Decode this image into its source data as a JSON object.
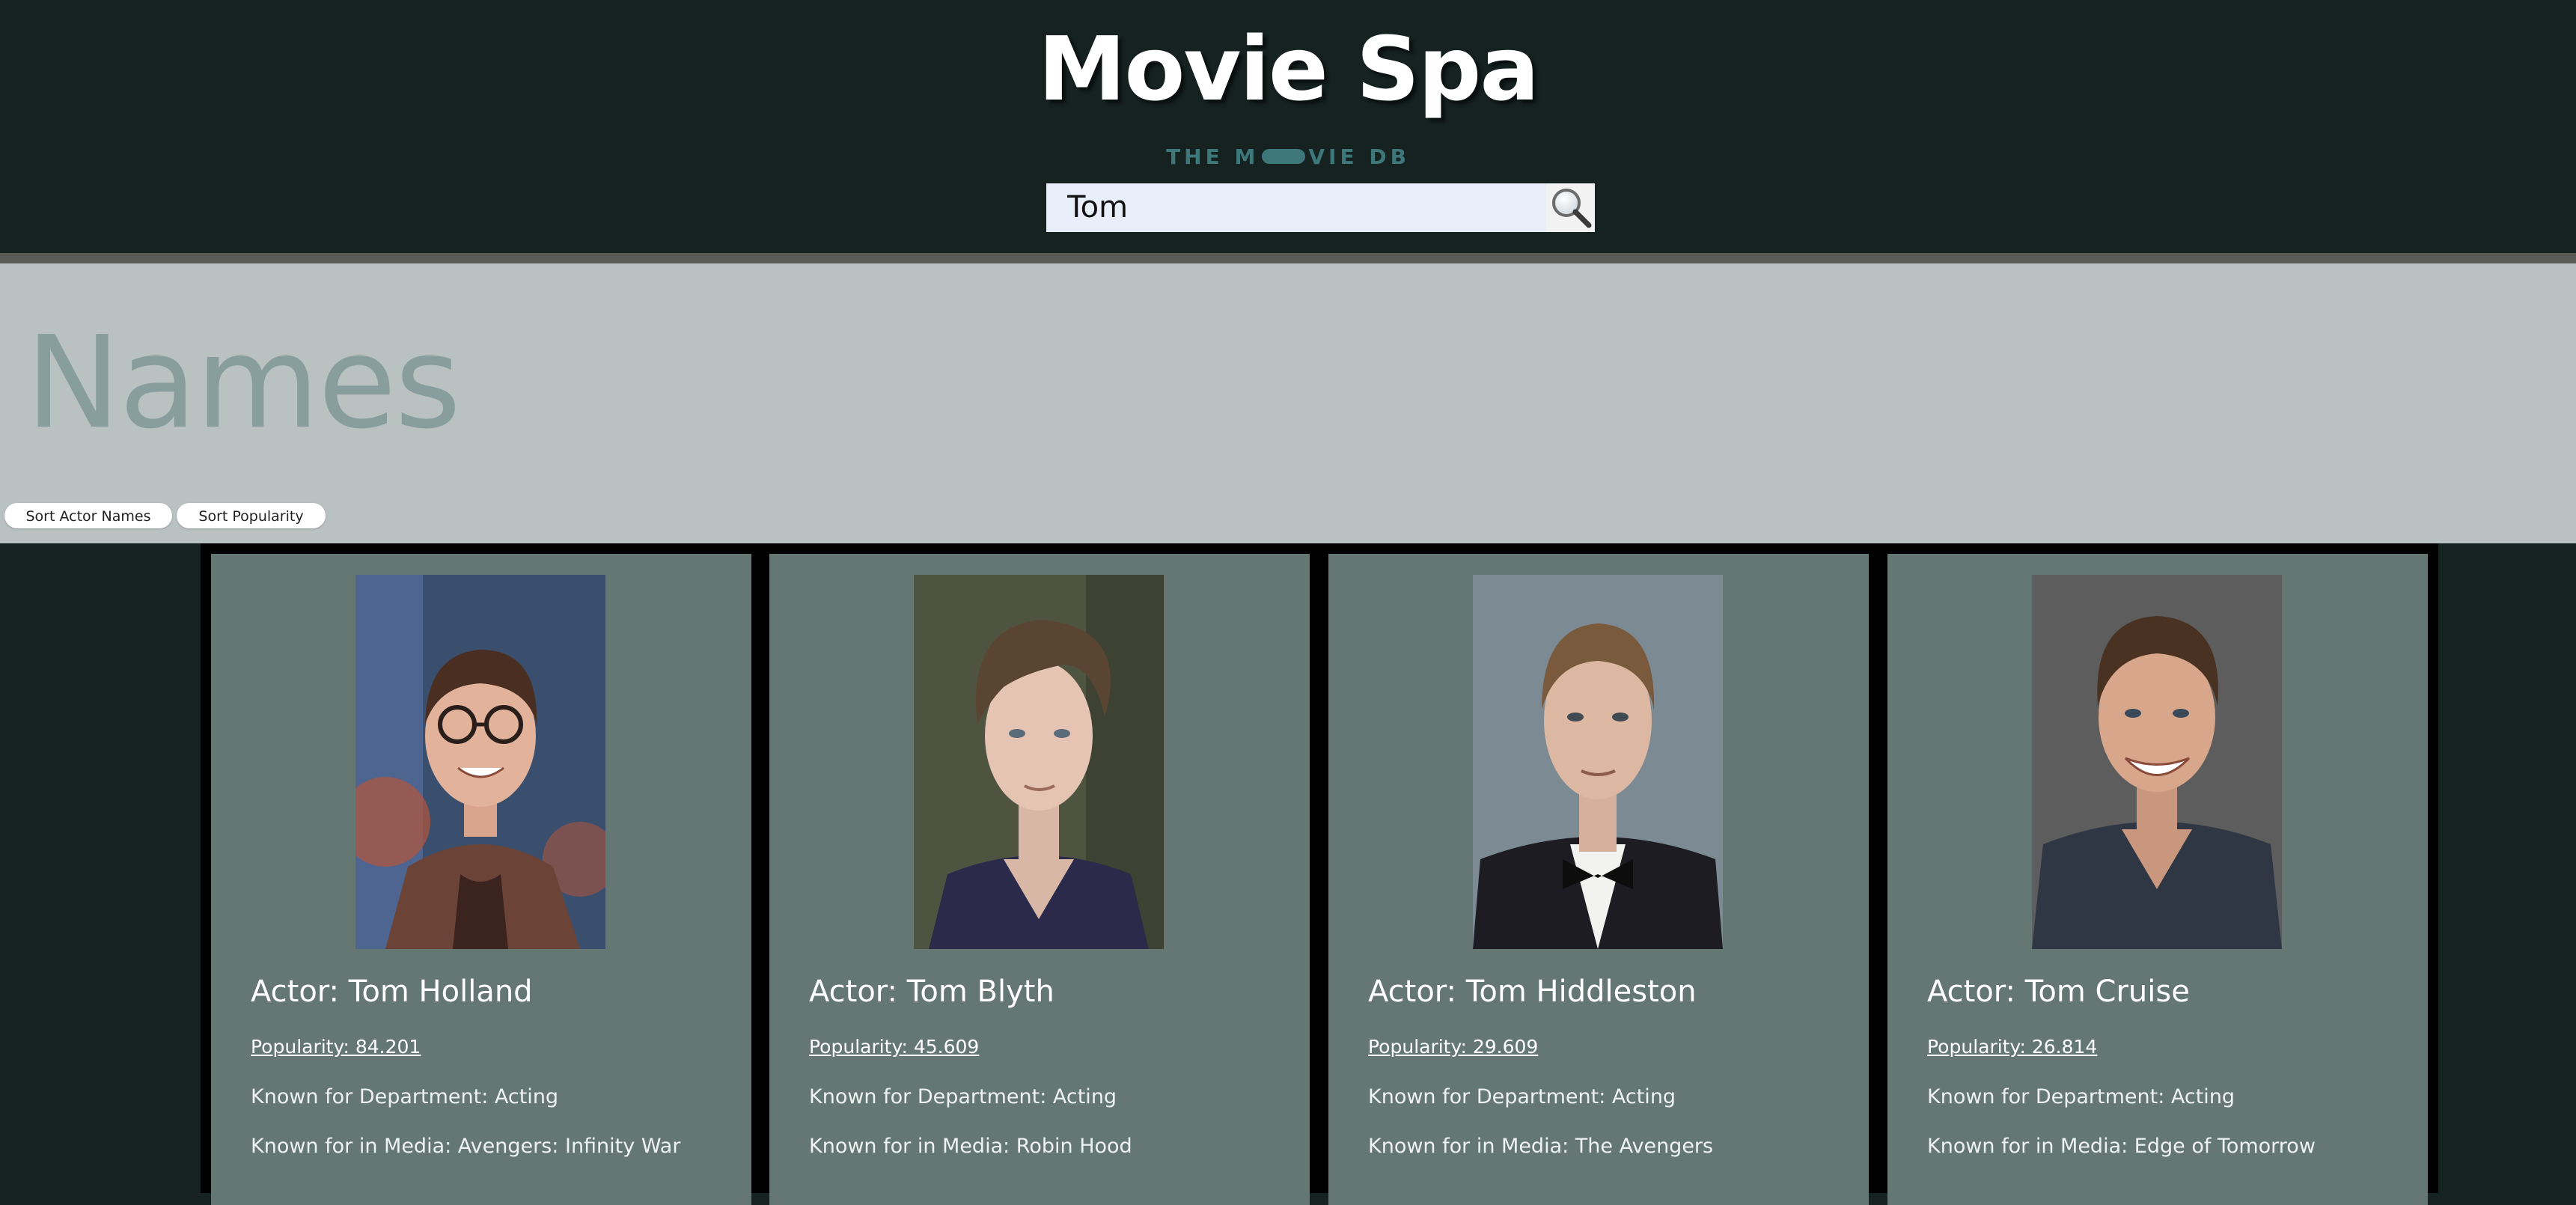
{
  "header": {
    "title": "Movie Spa",
    "logo_text_left": "THE M",
    "logo_text_right": "VIE DB"
  },
  "search": {
    "value": "Tom",
    "icon": "magnifier-icon"
  },
  "names_section": {
    "title": "Names",
    "sort_names_label": "Sort Actor Names",
    "sort_popularity_label": "Sort Popularity"
  },
  "cards": [
    {
      "name": "Actor: Tom Holland",
      "popularity": "Popularity: 84.201",
      "department": "Known for Department: Acting",
      "media": "Known for in Media: Avengers: Infinity War"
    },
    {
      "name": "Actor: Tom Blyth",
      "popularity": "Popularity: 45.609",
      "department": "Known for Department: Acting",
      "media": "Known for in Media: Robin Hood"
    },
    {
      "name": "Actor: Tom Hiddleston",
      "popularity": "Popularity: 29.609",
      "department": "Known for Department: Acting",
      "media": "Known for in Media: The Avengers"
    },
    {
      "name": "Actor: Tom Cruise",
      "popularity": "Popularity: 26.814",
      "department": "Known for Department: Acting",
      "media": "Known for in Media: Edge of Tomorrow"
    }
  ],
  "colors": {
    "header_bg": "#152220",
    "band_bg": "#b9c1c1",
    "card_bg": "#647772",
    "logo_teal": "#3d7779",
    "search_bg": "#e8effb"
  }
}
